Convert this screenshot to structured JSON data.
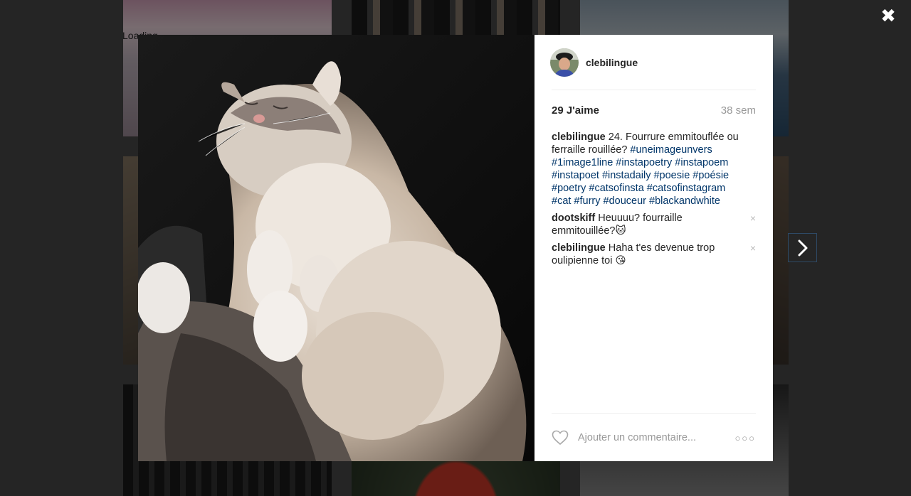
{
  "loading_text": "Loading",
  "close_label": "✖",
  "post": {
    "author": "clebilingue",
    "likes": "29 J'aime",
    "time_ago": "38 sem",
    "caption_user": "clebilingue",
    "caption_text": "24. Fourrure emmitouflée ou ferraille rouillée?",
    "caption_tags": "#uneimageunvers #1image1line #instapoetry #instapoem #instapoet #instadaily #poesie #poésie #poetry #catsofinsta #catsofinstagram #cat #furry #douceur #blackandwhite",
    "comments": [
      {
        "user": "dootskiff",
        "text": "Heuuuu? fourraille emmitouillée?🐱",
        "delete": "×"
      },
      {
        "user": "clebilingue",
        "text": "Haha t'es devenue trop oulipienne toi 😘",
        "delete": "×"
      }
    ],
    "comment_placeholder": "Ajouter un commentaire...",
    "more_label": "○○○"
  },
  "colors": {
    "hashtag": "#003569",
    "muted": "#999999",
    "text": "#262626",
    "divider": "#efefef"
  },
  "icons": {
    "close": "close-icon",
    "next": "chevron-right-icon",
    "like": "heart-icon",
    "more": "more-options-icon"
  }
}
